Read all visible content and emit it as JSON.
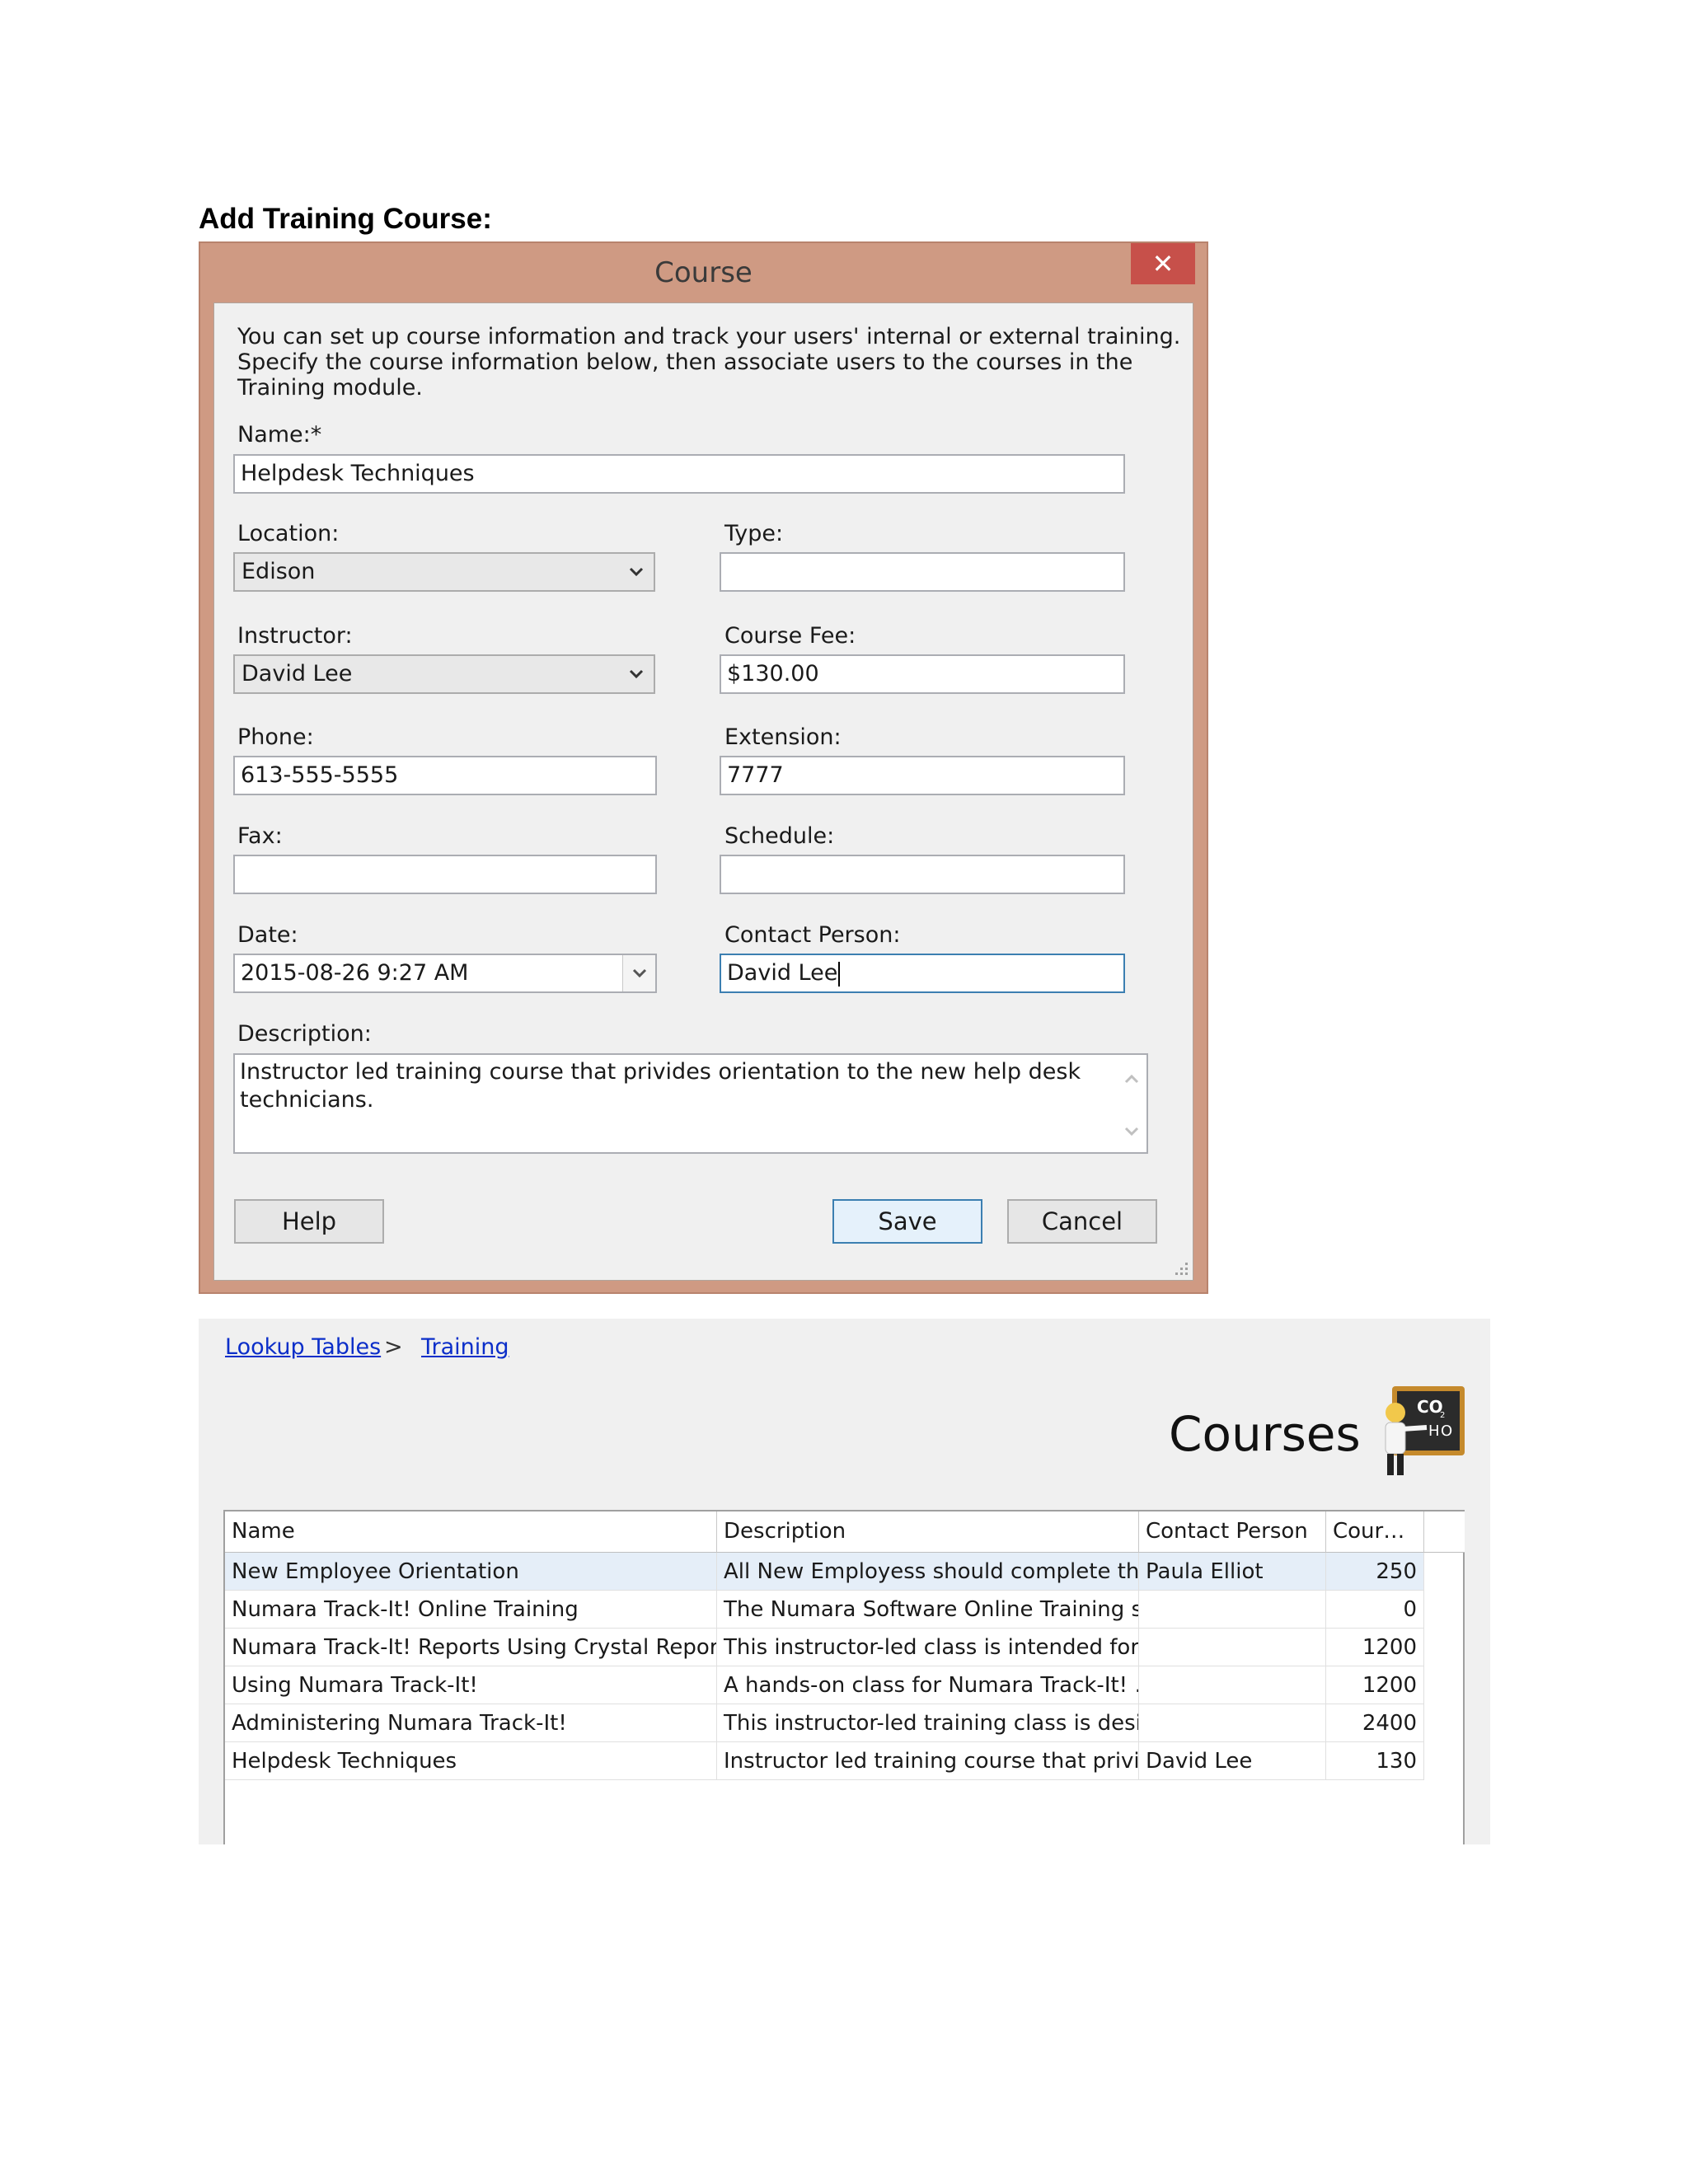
{
  "heading": "Add Training Course:",
  "dialog": {
    "title": "Course",
    "close_glyph": "✕",
    "intro": "You can set up course information and track your users' internal or external training. Specify the course information below, then associate users to the courses in the Training module.",
    "fields": {
      "name": {
        "label": "Name:*",
        "value": "Helpdesk Techniques"
      },
      "location": {
        "label": "Location:",
        "value": "Edison"
      },
      "type": {
        "label": "Type:",
        "value": ""
      },
      "instructor": {
        "label": "Instructor:",
        "value": "David Lee"
      },
      "course_fee": {
        "label": "Course Fee:",
        "value": "$130.00"
      },
      "phone": {
        "label": "Phone:",
        "value": "613-555-5555"
      },
      "extension": {
        "label": "Extension:",
        "value": "7777"
      },
      "fax": {
        "label": "Fax:",
        "value": ""
      },
      "schedule": {
        "label": "Schedule:",
        "value": ""
      },
      "date": {
        "label": "Date:",
        "value": "2015-08-26 9:27 AM"
      },
      "contact_person": {
        "label": "Contact Person:",
        "value": "David Lee"
      },
      "description": {
        "label": "Description:",
        "value": "Instructor led training course that privides orientation to the new help desk technicians."
      }
    },
    "buttons": {
      "help": "Help",
      "save": "Save",
      "cancel": "Cancel"
    }
  },
  "courses_panel": {
    "breadcrumb": [
      "Lookup Tables",
      "Training"
    ],
    "breadcrumb_sep": ">",
    "title": "Courses",
    "icon": "chalkboard-teacher-icon",
    "columns": [
      "Name",
      "Description",
      "Contact Person",
      "Cour…"
    ],
    "rows": [
      {
        "name": "New Employee Orientation",
        "description": "All New Employess should complete this…",
        "contact": "Paula Elliot",
        "fee": "250"
      },
      {
        "name": "Numara Track-It! Online Training",
        "description": "The Numara Software Online Training s…",
        "contact": "",
        "fee": "0"
      },
      {
        "name": "Numara Track-It! Reports Using Crystal Reports",
        "description": "This instructor-led class is intended for …",
        "contact": "",
        "fee": "1200"
      },
      {
        "name": "Using Numara Track-It!",
        "description": "A hands-on class for Numara Track-It! …",
        "contact": "",
        "fee": "1200"
      },
      {
        "name": "Administering Numara Track-It!",
        "description": "This instructor-led training class is desig…",
        "contact": "",
        "fee": "2400"
      },
      {
        "name": "Helpdesk Techniques",
        "description": "Instructor led training course that privi…",
        "contact": "David Lee",
        "fee": "130"
      }
    ]
  },
  "colors": {
    "dialog_frame": "#cf9a83",
    "close_button": "#c7504a",
    "link": "#0b2ec9",
    "selected_row": "#e5eef8"
  }
}
